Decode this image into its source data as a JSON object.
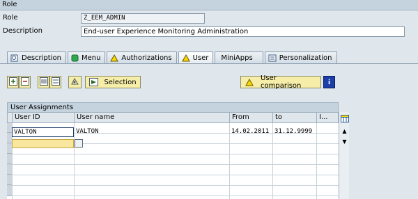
{
  "role_section": {
    "header": "Role",
    "role_label": "Role",
    "role_value": "Z_EEM_ADMIN",
    "description_label": "Description",
    "description_value": "End-user Experience Monitoring Administration"
  },
  "tabs": [
    {
      "label": "Description",
      "icon": "description-icon"
    },
    {
      "label": "Menu",
      "icon": "menu-icon"
    },
    {
      "label": "Authorizations",
      "icon": "warning-triangle-icon"
    },
    {
      "label": "User",
      "icon": "warning-triangle-icon"
    },
    {
      "label": "MiniApps",
      "icon": ""
    },
    {
      "label": "Personalization",
      "icon": "personalization-icon"
    }
  ],
  "toolbar": {
    "selection_label": "Selection",
    "user_comparison_label": "User comparison"
  },
  "table": {
    "title": "User Assignments",
    "columns": [
      "User ID",
      "User name",
      "From",
      "to",
      "I..."
    ],
    "rows": [
      {
        "user_id": "VALTON",
        "user_name": "VALTON",
        "from": "14.02.2011",
        "to": "31.12.9999"
      }
    ]
  },
  "colors": {
    "background": "#dfe6ec",
    "button_yellow": "#f5eda8",
    "header_blue": "#c5d3df",
    "new_row_yellow": "#f9e7a0"
  }
}
